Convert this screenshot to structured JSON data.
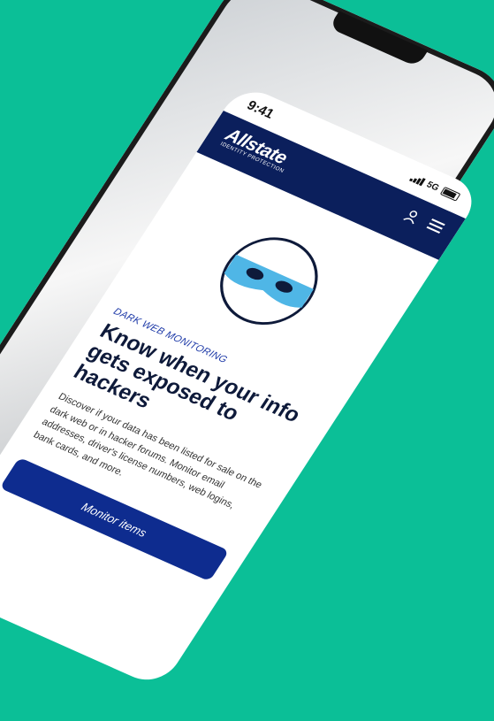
{
  "status_bar": {
    "time": "9:41",
    "network": "5G"
  },
  "header": {
    "brand": "Allstate",
    "tagline": "IDENTITY PROTECTION"
  },
  "icons": {
    "account": "user-icon",
    "menu": "menu-icon",
    "hero": "mask-icon"
  },
  "hero": {
    "eyebrow": "DARK WEB MONITORING",
    "headline_line1": "Know when your info",
    "headline_line2": "gets exposed to hackers",
    "body": "Discover if your data has been listed for sale on the dark web or in hacker forums. Monitor email addresses, driver's license numbers, web logins, bank cards, and more."
  },
  "cta": {
    "label": "Monitor items"
  },
  "colors": {
    "background": "#0bbf97",
    "header": "#0b1f5c",
    "button": "#0e2c8f",
    "accent": "#1e3aa8",
    "mask": "#4fb6e6"
  }
}
